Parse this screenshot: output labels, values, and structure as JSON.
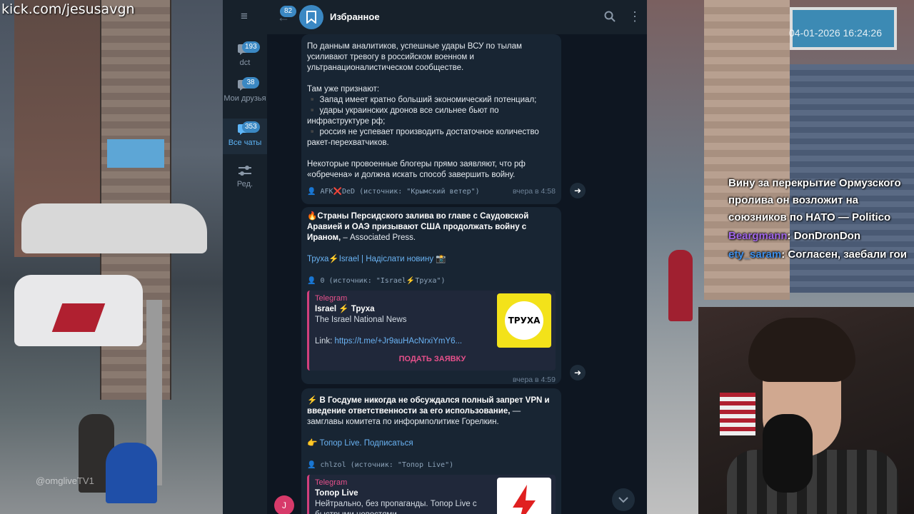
{
  "stream": {
    "url": "kick.com/jesusavgn",
    "cam_left_watermark": "@omgliveTV1",
    "cam_right_timestamp": "04-01-2026 16:24:26"
  },
  "chat_overlay": {
    "lines": [
      {
        "user": "",
        "text": "Вину за перекрытие Ормузского пролива он возложит на союзников по НАТО — Politico"
      },
      {
        "user": "Beargmann",
        "text": ": DonDronDon"
      },
      {
        "user": "ety_saram",
        "text": ": Согласен, заебали гои"
      }
    ]
  },
  "telegram": {
    "header": {
      "back_badge": "82",
      "title": "Избранное"
    },
    "folders": [
      {
        "label": "dct",
        "badge": "193"
      },
      {
        "label": "Мои друзья",
        "badge": "38"
      },
      {
        "label": "Все чаты",
        "badge": "353"
      },
      {
        "label": "Ред.",
        "badge": ""
      }
    ],
    "messages": [
      {
        "paragraphs": [
          "По данным аналитиков, успешные удары ВСУ по тылам усиливают тревогу в российском военном и ультранационалистическом сообществе.",
          "Там уже признают:",
          "▪️ Запад имеет кратно больший экономический потенциал;",
          "▪️ удары украинских дронов все сильнее бьют по инфраструктуре рф;",
          "▪️ россия не успевает производить достаточное количество ракет-перехватчиков.",
          "Некоторые провоенные блогеры прямо заявляют, что рф «обречена» и должна искать способ завершить войну."
        ],
        "source": "👤 AFK❌DeD (источник: \"Крымский ветер\")",
        "time": "вчера в 4:58"
      },
      {
        "headline": "🔥Страны Персидского залива во главе с Саудовской Аравией и ОАЭ призывают США продолжать войну с Ираном,",
        "body": " – Associated Press.",
        "channel_link": "Труха⚡️Israel | Надіслати новину 📸",
        "source": "👤 0 (источник: \"Israel⚡️Труха\")",
        "preview": {
          "site": "Telegram",
          "name": "Israel ⚡️ Труха",
          "desc": "The Israel National News",
          "link_label": "Link: ",
          "link": "https://t.me/+Jr9auHAcNrxiYmY6...",
          "thumb_text": "ТРУХА",
          "action": "ПОДАТЬ ЗАЯВКУ"
        },
        "time": "вчера в 4:59"
      },
      {
        "headline": "⚡️ В Госдуме никогда не обсуждался полный запрет VPN и введение ответственности за его использование,",
        "body": " — замглавы комитета по информполитике Горелкин.",
        "channel_link": "👉 Топор Live. Подписаться",
        "source": "👤 chlzol (источник: \"Топор Live\")",
        "preview": {
          "site": "Telegram",
          "name": "Топор Live",
          "desc": "Нейтрально, без пропаганды. Топор Live с быстрыми новостями."
        }
      }
    ],
    "input_avatar_letter": "J"
  },
  "colors": {
    "telegram_bg": "#0e1621",
    "bubble": "#182533",
    "accent": "#3b88c3",
    "link": "#6ab3f3",
    "preview_accent": "#e6508b"
  }
}
